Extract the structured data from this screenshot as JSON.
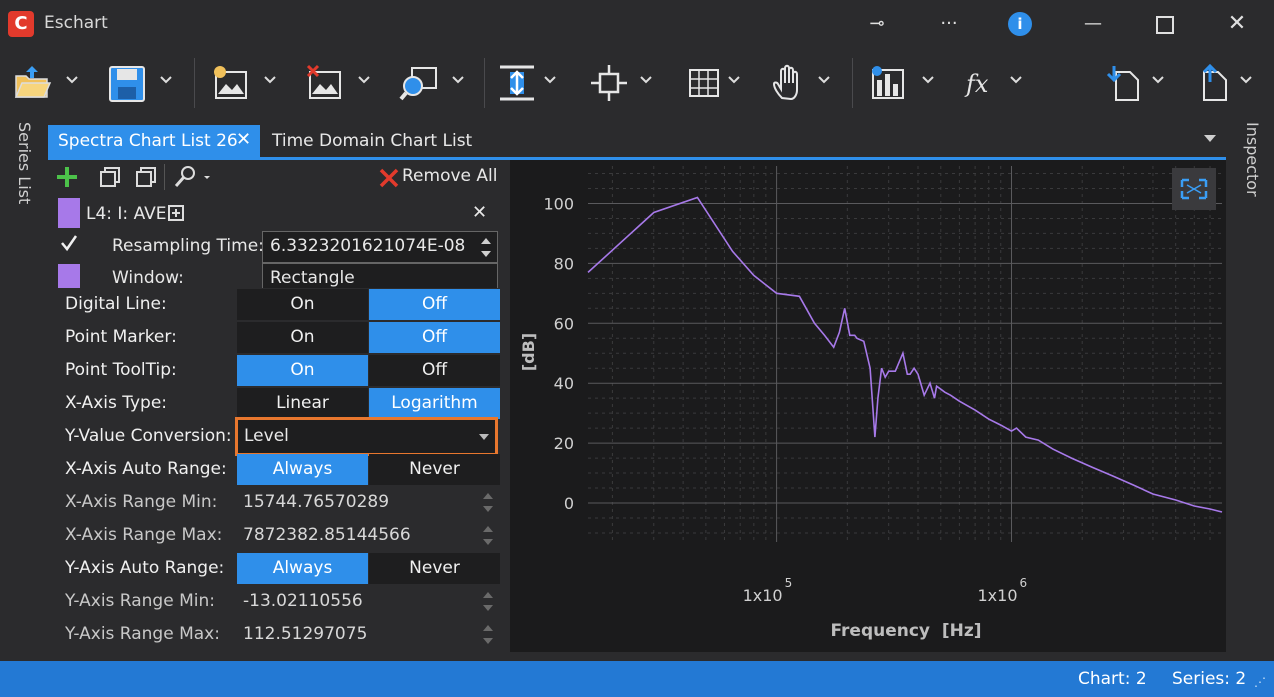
{
  "window": {
    "title": "Eschart",
    "logo_letter": "C"
  },
  "tabs": [
    {
      "label": "Spectra Chart List 26",
      "close": "✕"
    },
    {
      "label": "Time Domain Chart List"
    }
  ],
  "side_tabs": {
    "left": "Series List",
    "right": "Inspector"
  },
  "series_toolbar": {
    "remove_all": "Remove All"
  },
  "series_item": {
    "title": "L4: I: AVE",
    "close": "✕",
    "resampling_label": "Resampling Time:",
    "resampling_value": "6.3323201621074E-08",
    "window_label": "Window:",
    "window_value": "Rectangle",
    "color": "#a779e9"
  },
  "properties": {
    "digital_line": {
      "label": "Digital Line:",
      "on": "On",
      "off": "Off",
      "selected": "Off"
    },
    "point_marker": {
      "label": "Point Marker:",
      "on": "On",
      "off": "Off",
      "selected": "Off"
    },
    "point_tooltip": {
      "label": "Point ToolTip:",
      "on": "On",
      "off": "Off",
      "selected": "On"
    },
    "x_axis_type": {
      "label": "X-Axis Type:",
      "linear": "Linear",
      "log": "Logarithm",
      "selected": "Logarithm"
    },
    "y_value_conversion": {
      "label": "Y-Value Conversion:",
      "value": "Level",
      "highlight": "#e8772e"
    },
    "x_auto_range": {
      "label": "X-Axis Auto Range:",
      "always": "Always",
      "never": "Never",
      "selected": "Always"
    },
    "x_range_min": {
      "label": "X-Axis Range Min:",
      "value": "15744.76570289"
    },
    "x_range_max": {
      "label": "X-Axis Range Max:",
      "value": "7872382.85144566"
    },
    "y_auto_range": {
      "label": "Y-Axis Auto Range:",
      "always": "Always",
      "never": "Never",
      "selected": "Always"
    },
    "y_range_min": {
      "label": "Y-Axis Range Min:",
      "value": "-13.02110556"
    },
    "y_range_max": {
      "label": "Y-Axis Range Max:",
      "value": "112.51297075"
    }
  },
  "status": {
    "chart": "Chart: 2",
    "series": "Series: 2"
  },
  "colors": {
    "accent": "#2f8fea",
    "status_bar": "#2379d4",
    "series": "#a779e9"
  },
  "chart_data": {
    "type": "line",
    "xlabel": "Frequency  [Hz]",
    "ylabel": "[dB]",
    "x_scale": "log",
    "x_ticks": [
      {
        "value": 100000,
        "base": "1x10",
        "exp": "5"
      },
      {
        "value": 1000000,
        "base": "1x10",
        "exp": "6"
      }
    ],
    "y_ticks": [
      0,
      20,
      40,
      60,
      80,
      100
    ],
    "xlim": [
      15744.76570289,
      7872382.85144566
    ],
    "ylim": [
      -13.02110556,
      112.51297075
    ],
    "grid": true,
    "series": [
      {
        "color": "#a779e9",
        "x": [
          15745,
          30000,
          46000,
          65000,
          80000,
          100000,
          125000,
          145000,
          160000,
          175000,
          185000,
          195000,
          205000,
          215000,
          220000,
          235000,
          250000,
          262000,
          270000,
          280000,
          290000,
          300000,
          320000,
          345000,
          360000,
          370000,
          385000,
          400000,
          425000,
          450000,
          470000,
          480000,
          500000,
          520000,
          550000,
          600000,
          700000,
          800000,
          900000,
          1000000,
          1050000,
          1150000,
          1300000,
          1500000,
          1800000,
          2200000,
          2700000,
          3300000,
          4000000,
          5000000,
          6000000,
          7000000,
          7872383
        ],
        "y": [
          77,
          97,
          102,
          84,
          76,
          70,
          69,
          60,
          56,
          52,
          57,
          65,
          56,
          56,
          55,
          54,
          45,
          22,
          35,
          45,
          42,
          44,
          44,
          50,
          43,
          43,
          45,
          43,
          36,
          40,
          35,
          39,
          38,
          37,
          36,
          34,
          31,
          28,
          26,
          24,
          25,
          22,
          21,
          18,
          15,
          12,
          9,
          6,
          3,
          1,
          -1,
          -2,
          -3
        ]
      }
    ]
  }
}
